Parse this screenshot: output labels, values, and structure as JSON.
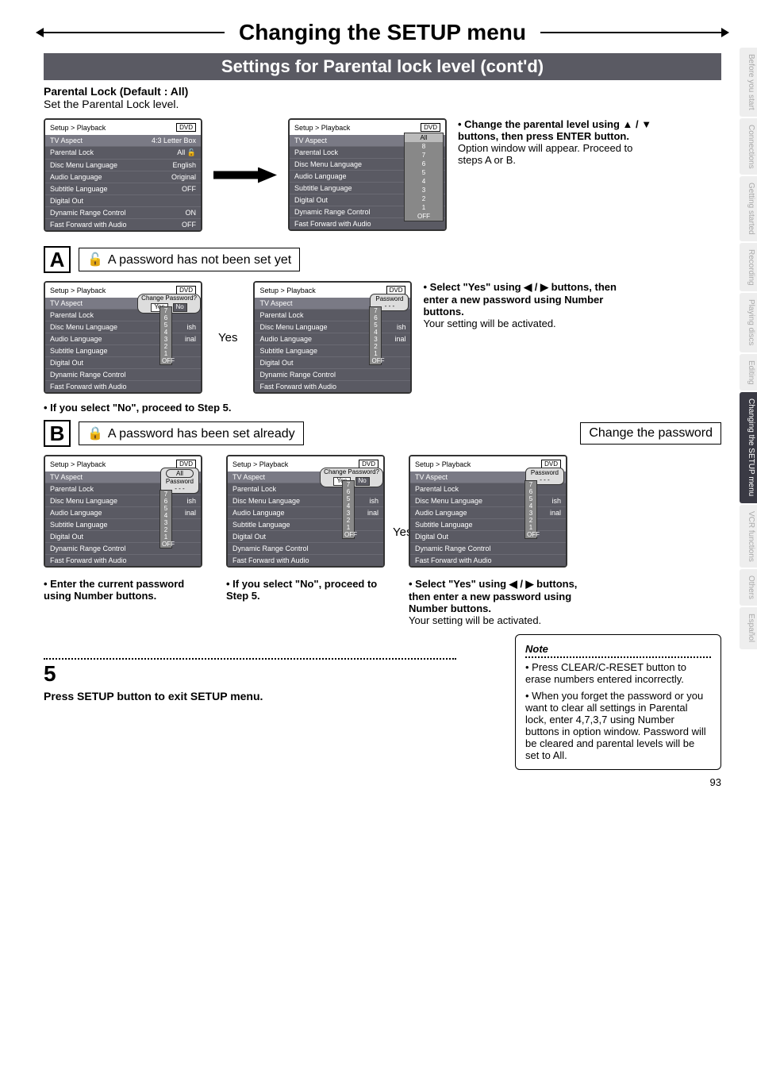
{
  "title": "Changing the SETUP menu",
  "subtitle": "Settings for Parental lock level (cont'd)",
  "heading": "Parental Lock (Default : All)",
  "sub": "Set the Parental Lock level.",
  "pageNum": "93",
  "sideTabs": [
    "Before you start",
    "Connections",
    "Getting started",
    "Recording",
    "Playing discs",
    "Editing",
    "Changing the SETUP menu",
    "VCR functions",
    "Others",
    "Español"
  ],
  "activeTab": "Changing the SETUP menu",
  "bc": "Setup > Playback",
  "dvd": "DVD",
  "menuItems": [
    {
      "k": "TV Aspect",
      "v": "4:3 Letter Box"
    },
    {
      "k": "Parental Lock",
      "v": "All"
    },
    {
      "k": "Disc Menu Language",
      "v": "English"
    },
    {
      "k": "Audio Language",
      "v": "Original"
    },
    {
      "k": "Subtitle Language",
      "v": "OFF"
    },
    {
      "k": "Digital Out",
      "v": ""
    },
    {
      "k": "Dynamic Range Control",
      "v": "ON"
    },
    {
      "k": "Fast Forward with Audio",
      "v": "OFF"
    }
  ],
  "levels": [
    "All",
    "8",
    "7",
    "6",
    "5",
    "4",
    "3",
    "2",
    "1",
    "OFF"
  ],
  "levelsShort": [
    "7",
    "6",
    "5",
    "4",
    "3",
    "2",
    "1",
    "OFF"
  ],
  "partialVals": [
    "etter Box",
    "",
    "ish",
    "inal"
  ],
  "instr1a": "• Change the parental level using ▲ / ▼ buttons, then press ENTER button.",
  "instr1b": "Option window will appear. Proceed to steps A or B.",
  "stepA_title": "A password has not been set yet",
  "yes": "Yes",
  "changePw": "Change Password?",
  "ynYes": "Yes",
  "ynNo": "No",
  "pwLabel": "Password",
  "pwMask": "- - -",
  "instrA2a": "• Select \"Yes\" using ◀ / ▶ buttons, then enter a new password using Number buttons.",
  "instrA2b": "Your setting will be activated.",
  "noteA": "• If you select \"No\", proceed to Step 5.",
  "stepB_title": "A password has been set already",
  "changePwTitle": "Change the password",
  "noteB1": "• Enter the current password using Number buttons.",
  "noteB2": "• If you select \"No\", proceed to Step 5.",
  "instrB3a": "• Select \"Yes\" using ◀ / ▶ buttons, then enter a new password using Number buttons.",
  "instrB3b": "Your setting will be activated.",
  "noteTitle": "Note",
  "noteBody1": "• Press CLEAR/C-RESET button to erase numbers entered incorrectly.",
  "noteBody2": "• When you forget the password or you want to clear all settings in Parental lock, enter 4,7,3,7 using Number buttons in option window. Password will be cleared and parental levels will be set to All.",
  "step5": "5",
  "step5text": "Press SETUP button to exit SETUP menu.",
  "allBadge": "All"
}
